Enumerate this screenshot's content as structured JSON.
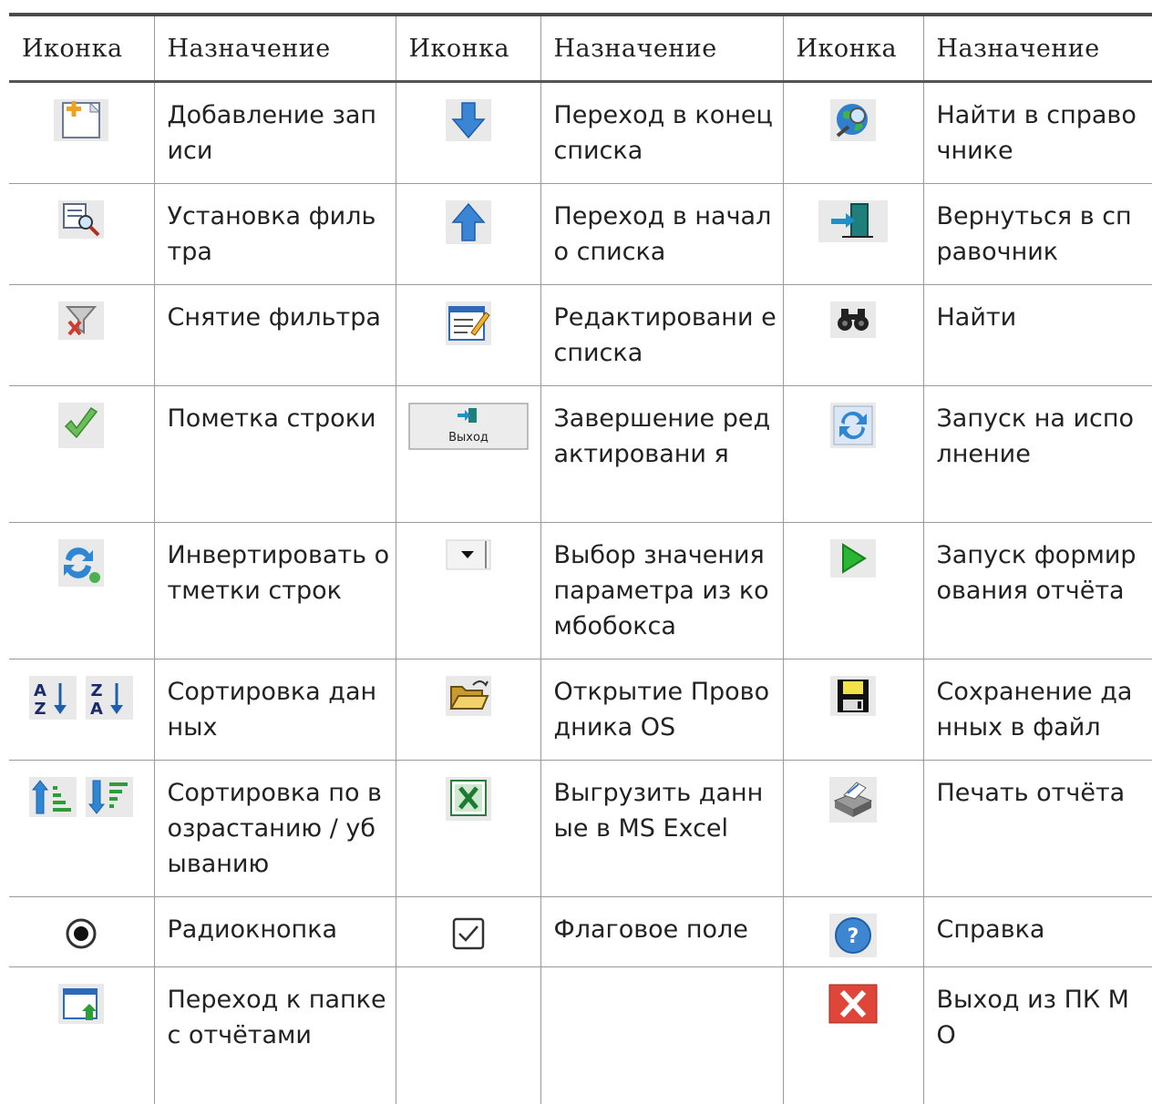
{
  "headers": [
    "Иконка",
    "Назначение",
    "Иконка",
    "Назначение",
    "Иконка",
    "Назначение"
  ],
  "rows": [
    {
      "c1": {
        "icons": [
          "add-record-icon"
        ],
        "text": "Добавление записи"
      },
      "c2": {
        "icons": [
          "arrow-down-icon"
        ],
        "text": "Переход в конец списка"
      },
      "c3": {
        "icons": [
          "globe-search-icon"
        ],
        "text": "Найти в справочнике"
      }
    },
    {
      "c1": {
        "icons": [
          "filter-search-icon"
        ],
        "text": "Установка фильтра"
      },
      "c2": {
        "icons": [
          "arrow-up-icon"
        ],
        "text": "Переход в начало списка"
      },
      "c3": {
        "icons": [
          "return-door-icon"
        ],
        "text": "Вернуться в справочник"
      }
    },
    {
      "c1": {
        "icons": [
          "filter-remove-icon"
        ],
        "text": "Снятие фильтра"
      },
      "c2": {
        "icons": [
          "edit-list-icon"
        ],
        "text": "Редактировани е списка"
      },
      "c3": {
        "icons": [
          "binoculars-icon"
        ],
        "text": "Найти"
      }
    },
    {
      "c1": {
        "icons": [
          "checkmark-icon"
        ],
        "text": "Пометка строки"
      },
      "c2": {
        "icons": [
          "exit-button-icon"
        ],
        "text": "Завершение редактировани я",
        "button_label": "Выход"
      },
      "c3": {
        "icons": [
          "refresh-icon"
        ],
        "text": "Запуск на исполнение"
      }
    },
    {
      "c1": {
        "icons": [
          "invert-marks-icon"
        ],
        "text": "Инвертировать отметки строк"
      },
      "c2": {
        "icons": [
          "combobox-arrow-icon"
        ],
        "text": "Выбор значения параметра из комбобокса"
      },
      "c3": {
        "icons": [
          "play-icon"
        ],
        "text": "Запуск формирования отчёта"
      }
    },
    {
      "c1": {
        "icons": [
          "sort-az-icon",
          "sort-za-icon"
        ],
        "text": "Сортировка данных"
      },
      "c2": {
        "icons": [
          "open-folder-icon"
        ],
        "text": "Открытие Проводника OS"
      },
      "c3": {
        "icons": [
          "floppy-save-icon"
        ],
        "text": "Сохранение данных в файл"
      }
    },
    {
      "c1": {
        "icons": [
          "sort-ascending-icon",
          "sort-descending-icon"
        ],
        "text": "Сортировка по возрастанию / убыванию"
      },
      "c2": {
        "icons": [
          "excel-icon"
        ],
        "text": "Выгрузить данные в MS Excel"
      },
      "c3": {
        "icons": [
          "printer-icon"
        ],
        "text": "Печать отчёта"
      }
    },
    {
      "c1": {
        "icons": [
          "radio-button-icon"
        ],
        "text": "Радиокнопка"
      },
      "c2": {
        "icons": [
          "checkbox-icon"
        ],
        "text": "Флаговое поле"
      },
      "c3": {
        "icons": [
          "help-icon"
        ],
        "text": "Справка"
      }
    },
    {
      "c1": {
        "icons": [
          "reports-folder-icon"
        ],
        "text": "Переход к папке с отчётами"
      },
      "c2": {
        "icons": [],
        "text": ""
      },
      "c3": {
        "icons": [
          "close-icon"
        ],
        "text": "Выход из ПК МО"
      }
    }
  ]
}
